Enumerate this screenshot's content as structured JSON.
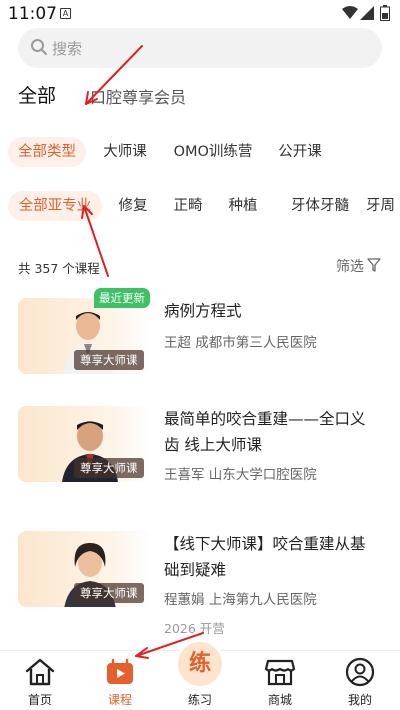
{
  "status": {
    "time": "11:07",
    "a_icon": "A"
  },
  "search": {
    "placeholder": "搜索"
  },
  "category_tabs": [
    {
      "label": "全部",
      "active": true
    },
    {
      "label": "口腔尊享会员",
      "active": false
    }
  ],
  "type_chips": [
    {
      "label": "全部类型",
      "active": true
    },
    {
      "label": "大师课",
      "active": false
    },
    {
      "label": "OMO训练营",
      "active": false
    },
    {
      "label": "公开课",
      "active": false
    }
  ],
  "specialty_chips": [
    {
      "label": "全部亚专业",
      "active": true
    },
    {
      "label": "修复",
      "active": false
    },
    {
      "label": "正畸",
      "active": false
    },
    {
      "label": "种植",
      "active": false
    },
    {
      "label": "牙体牙髓",
      "active": false
    },
    {
      "label": "牙周",
      "active": false
    }
  ],
  "list": {
    "count_text": "共 357 个课程",
    "filter_label": "筛选"
  },
  "courses": [
    {
      "title": "病例方程式",
      "teacher": "王超 成都市第三人民医院",
      "badge": "最近更新",
      "thumb_label": "尊享大师课",
      "extra": ""
    },
    {
      "title": "最简单的咬合重建——全口义齿 线上大师课",
      "teacher": "王喜军 山东大学口腔医院",
      "badge": "",
      "thumb_label": "尊享大师课",
      "extra": ""
    },
    {
      "title": "【线下大师课】咬合重建从基础到疑难",
      "teacher": "程蕙娟 上海第九人民医院",
      "badge": "",
      "thumb_label": "尊享大师课",
      "extra": "2026 开营"
    }
  ],
  "tab_bar": [
    {
      "label": "首页",
      "icon": "home-icon",
      "active": false
    },
    {
      "label": "课程",
      "icon": "course-icon",
      "active": true
    },
    {
      "label": "练习",
      "icon": "practice-icon",
      "active": false,
      "glyph": "练"
    },
    {
      "label": "商城",
      "icon": "store-icon",
      "active": false
    },
    {
      "label": "我的",
      "icon": "profile-icon",
      "active": false
    }
  ],
  "colors": {
    "accent": "#e4612d",
    "chip_active_bg": "#fdf0e8",
    "badge_green": "#3ec065",
    "annotation_red": "#e02020"
  }
}
